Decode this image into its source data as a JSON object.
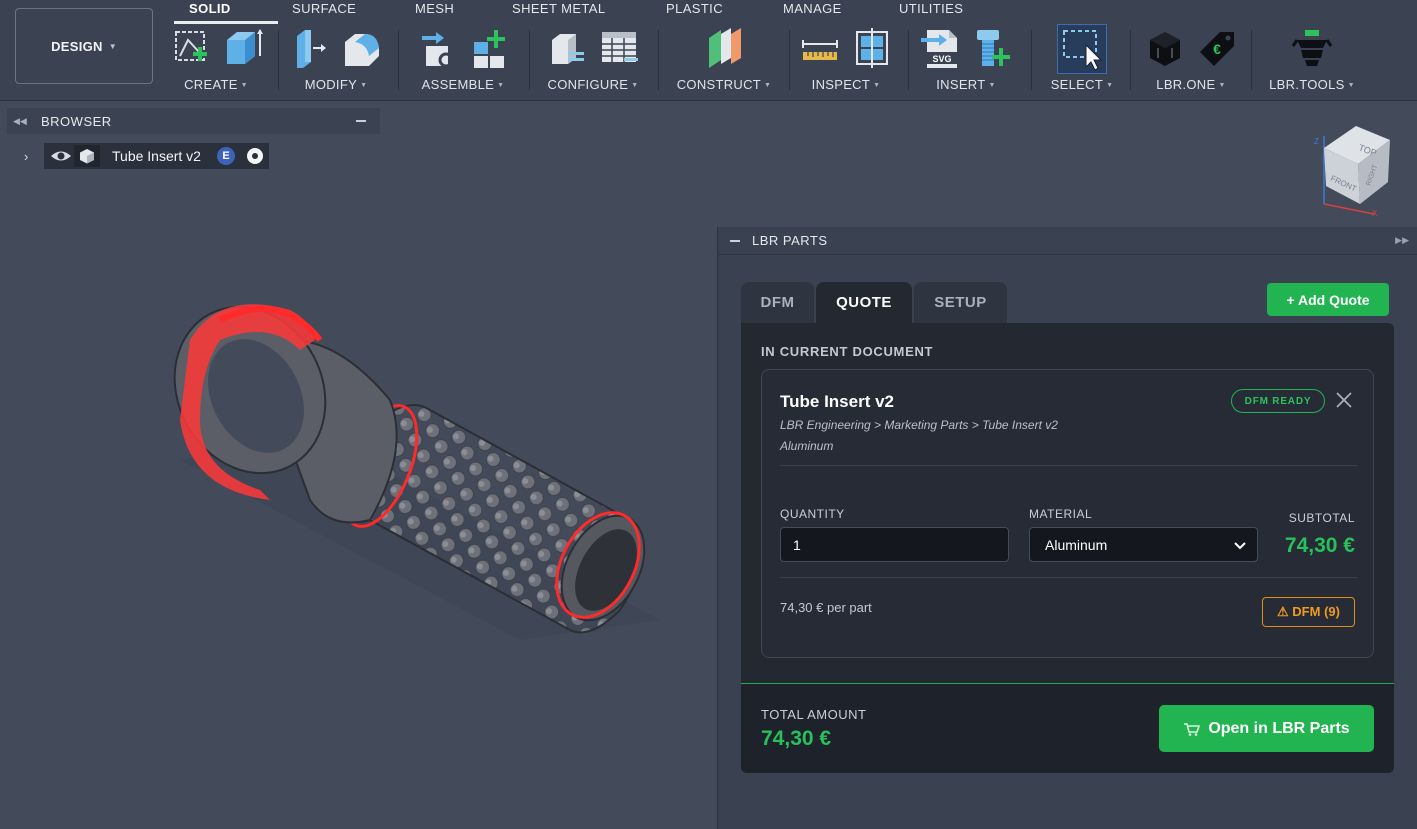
{
  "toolbar": {
    "design_label": "DESIGN",
    "tabs": [
      "SOLID",
      "SURFACE",
      "MESH",
      "SHEET METAL",
      "PLASTIC",
      "MANAGE",
      "UTILITIES"
    ],
    "groups": [
      "CREATE",
      "MODIFY",
      "ASSEMBLE",
      "CONFIGURE",
      "CONSTRUCT",
      "INSPECT",
      "INSERT",
      "SELECT",
      "LBR.ONE",
      "LBR.TOOLS"
    ],
    "insert_svg_text": "SVG"
  },
  "browser": {
    "title": "BROWSER",
    "item_name": "Tube Insert v2",
    "badge": "E"
  },
  "viewcube": {
    "top": "TOP",
    "front": "FRONT",
    "right": "RIGHT",
    "axis_z": "Z",
    "axis_x": "X"
  },
  "panel": {
    "title": "LBR PARTS",
    "tabs": [
      "DFM",
      "QUOTE",
      "SETUP"
    ],
    "active_tab": "QUOTE",
    "add_quote": "+ Add Quote",
    "section_title": "IN CURRENT DOCUMENT",
    "part": {
      "name": "Tube Insert v2",
      "path": "LBR Engineering > Marketing Parts > Tube Insert v2",
      "material_text": "Aluminum",
      "status": "DFM READY",
      "quantity_label": "QUANTITY",
      "quantity": "1",
      "material_label": "MATERIAL",
      "material_value": "Aluminum",
      "subtotal_label": "SUBTOTAL",
      "subtotal": "74,30 €",
      "per_part": "74,30 € per part",
      "dfm_warning": "⚠ DFM (9)"
    },
    "total_label": "TOTAL AMOUNT",
    "total": "74,30 €",
    "open_button": "Open in LBR Parts"
  },
  "colors": {
    "accent_green": "#21b451",
    "warning_orange": "#f09a22",
    "highlight_red": "#ff2a2a"
  }
}
